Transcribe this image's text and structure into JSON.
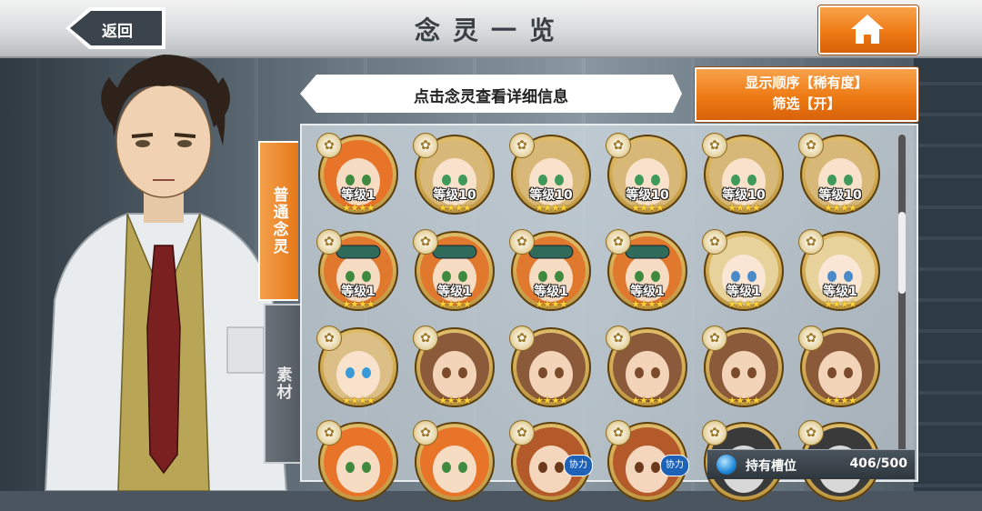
{
  "header": {
    "title": "念灵一览",
    "back_label": "返回"
  },
  "hint": "点击念灵查看详细信息",
  "sort": {
    "line1": "显示顺序【稀有度】",
    "line2": "筛选【开】"
  },
  "tabs": [
    {
      "label": "普通念灵",
      "active": true
    },
    {
      "label": "素材",
      "active": false
    }
  ],
  "units": [
    {
      "level": "等级1",
      "stars": "★★★★",
      "face": "orange",
      "assist": ""
    },
    {
      "level": "等级10",
      "stars": "★★★★",
      "face": "blonde",
      "assist": ""
    },
    {
      "level": "等级10",
      "stars": "★★★★",
      "face": "blonde",
      "assist": ""
    },
    {
      "level": "等级10",
      "stars": "★★★★",
      "face": "blonde",
      "assist": ""
    },
    {
      "level": "等级10",
      "stars": "★★★★",
      "face": "blonde",
      "assist": ""
    },
    {
      "level": "等级10",
      "stars": "★★★★",
      "face": "blonde",
      "assist": ""
    },
    {
      "level": "等级1",
      "stars": "★★★★",
      "face": "goggles",
      "assist": ""
    },
    {
      "level": "等级1",
      "stars": "★★★★",
      "face": "goggles",
      "assist": ""
    },
    {
      "level": "等级1",
      "stars": "★★★★",
      "face": "goggles",
      "assist": ""
    },
    {
      "level": "等级1",
      "stars": "★★★★",
      "face": "goggles",
      "assist": ""
    },
    {
      "level": "等级1",
      "stars": "★★★★",
      "face": "lightblonde",
      "assist": ""
    },
    {
      "level": "等级1",
      "stars": "★★★★",
      "face": "lightblonde",
      "assist": ""
    },
    {
      "level": "",
      "stars": "★★★★",
      "face": "blue-eyed",
      "assist": ""
    },
    {
      "level": "",
      "stars": "★★★★",
      "face": "brown",
      "assist": ""
    },
    {
      "level": "",
      "stars": "★★★★",
      "face": "brown",
      "assist": ""
    },
    {
      "level": "",
      "stars": "★★★★",
      "face": "brown",
      "assist": ""
    },
    {
      "level": "",
      "stars": "★★★★",
      "face": "brown",
      "assist": ""
    },
    {
      "level": "",
      "stars": "★★★★",
      "face": "brown",
      "assist": ""
    },
    {
      "level": "",
      "stars": "",
      "face": "orange",
      "assist": ""
    },
    {
      "level": "",
      "stars": "",
      "face": "orange",
      "assist": ""
    },
    {
      "level": "",
      "stars": "",
      "face": "auburn",
      "assist": "协力"
    },
    {
      "level": "",
      "stars": "",
      "face": "auburn",
      "assist": "协力"
    },
    {
      "level": "",
      "stars": "",
      "face": "dark",
      "assist": ""
    },
    {
      "level": "",
      "stars": "",
      "face": "dark",
      "assist": ""
    }
  ],
  "slots": {
    "label": "持有槽位",
    "count": "406/500"
  },
  "colors": {
    "accent_orange": "#ee7a14",
    "assist_blue": "#1e62b8",
    "star_gold": "#ffd23a"
  }
}
